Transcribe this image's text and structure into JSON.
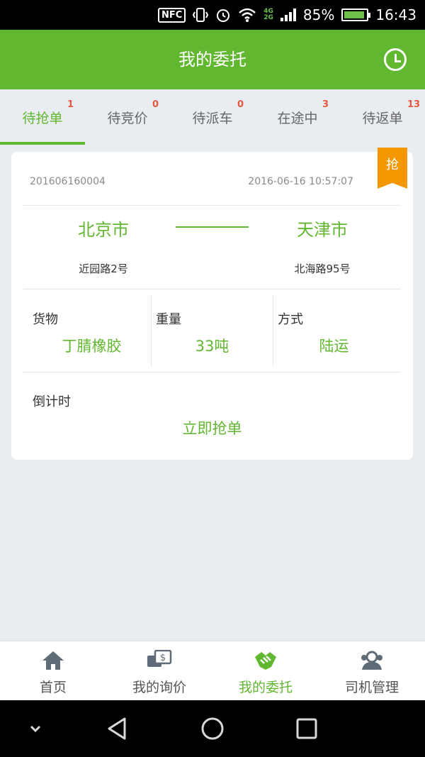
{
  "status_bar": {
    "nfc": "NFC",
    "network_top": "4G",
    "network_bottom": "2G",
    "battery": "85%",
    "time": "16:43"
  },
  "header": {
    "title": "我的委托",
    "history_icon": "clock-icon"
  },
  "tabs": [
    {
      "label": "待抢单",
      "count": "1",
      "active": true
    },
    {
      "label": "待竞价",
      "count": "0",
      "active": false
    },
    {
      "label": "待派车",
      "count": "0",
      "active": false
    },
    {
      "label": "在途中",
      "count": "3",
      "active": false
    },
    {
      "label": "待返单",
      "count": "13",
      "active": false
    }
  ],
  "order": {
    "badge": "抢",
    "order_no": "201606160004",
    "time": "2016-06-16 10:57:07",
    "from_city": "北京市",
    "to_city": "天津市",
    "from_address": "近园路2号",
    "to_address": "北海路95号",
    "goods_label": "货物",
    "goods_value": "丁腈橡胶",
    "weight_label": "重量",
    "weight_value": "33吨",
    "mode_label": "方式",
    "mode_value": "陆运",
    "countdown_label": "倒计时",
    "action_label": "立即抢单"
  },
  "bottom_nav": [
    {
      "label": "首页",
      "icon": "home-icon",
      "active": false
    },
    {
      "label": "我的询价",
      "icon": "price-inquiry-icon",
      "active": false
    },
    {
      "label": "我的委托",
      "icon": "handshake-icon",
      "active": true
    },
    {
      "label": "司机管理",
      "icon": "drivers-icon",
      "active": false
    }
  ],
  "colors": {
    "primary": "#62b730",
    "badge_red": "#e4583e",
    "grab_orange": "#f39800",
    "background": "#e9edf2"
  }
}
